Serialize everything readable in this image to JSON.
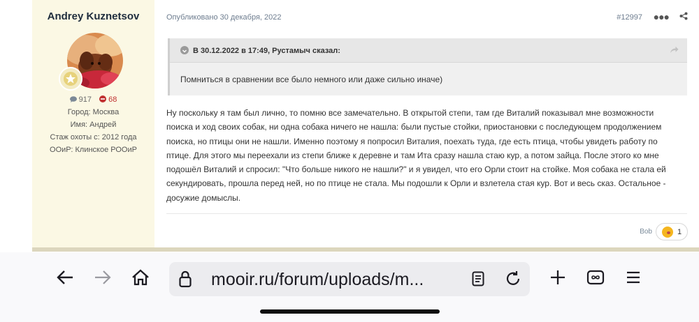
{
  "author": {
    "name": "Andrey Kuznetsov",
    "reputation_positive": "917",
    "reputation_negative": "68",
    "city": "Город: Москва",
    "first_name": "Имя: Андрей",
    "hunting_experience": "Стаж охоты с: 2012 года",
    "society": "ООиР: Клинское РООиР"
  },
  "post": {
    "published": "Опубликовано 30 декабря, 2022",
    "number": "#12997",
    "quote_header": "В 30.12.2022 в 17:49, Рустамыч сказал:",
    "quote_text": "Помниться в сравнении все было немного или даже сильно иначе)",
    "body_lines": [
      "Ну поскольку я там был лично, то помню все замечательно. В открытой степи, там где Виталий показывал мне возможности",
      "поиска и ход своих собак, ни одна собака ничего не нашла: были пустые стойки, приостановки с последующем продолжением",
      "поиска, но птицы они не нашли. Именно поэтому я попросил Виталия, поехать туда, где есть птица, чтобы увидеть работу по",
      "птице. Для этого мы переехали из степи ближе к деревне и там Ита сразу нашла стаю кур, а потом зайца. После этого ко мне",
      "подошёл Виталий и спросил: \"Что больше никого не нашли?\" и я увидел, что его Орли стоит на стойке. Моя собака не стала ей",
      "секундировать, прошла перед ней, но по птице не стала. Мы подошли к Орли и взлетела стая кур. Вот и весь сказ. Остальное -",
      "досужие домыслы."
    ],
    "reaction_user": "Bob",
    "reaction_count": "1"
  },
  "browser": {
    "url": "mooir.ru/forum/uploads/m..."
  },
  "colors": {
    "author_panel": "#fbf8e4",
    "negative": "#c03030",
    "reaction_emoji": "#f5b61f"
  }
}
